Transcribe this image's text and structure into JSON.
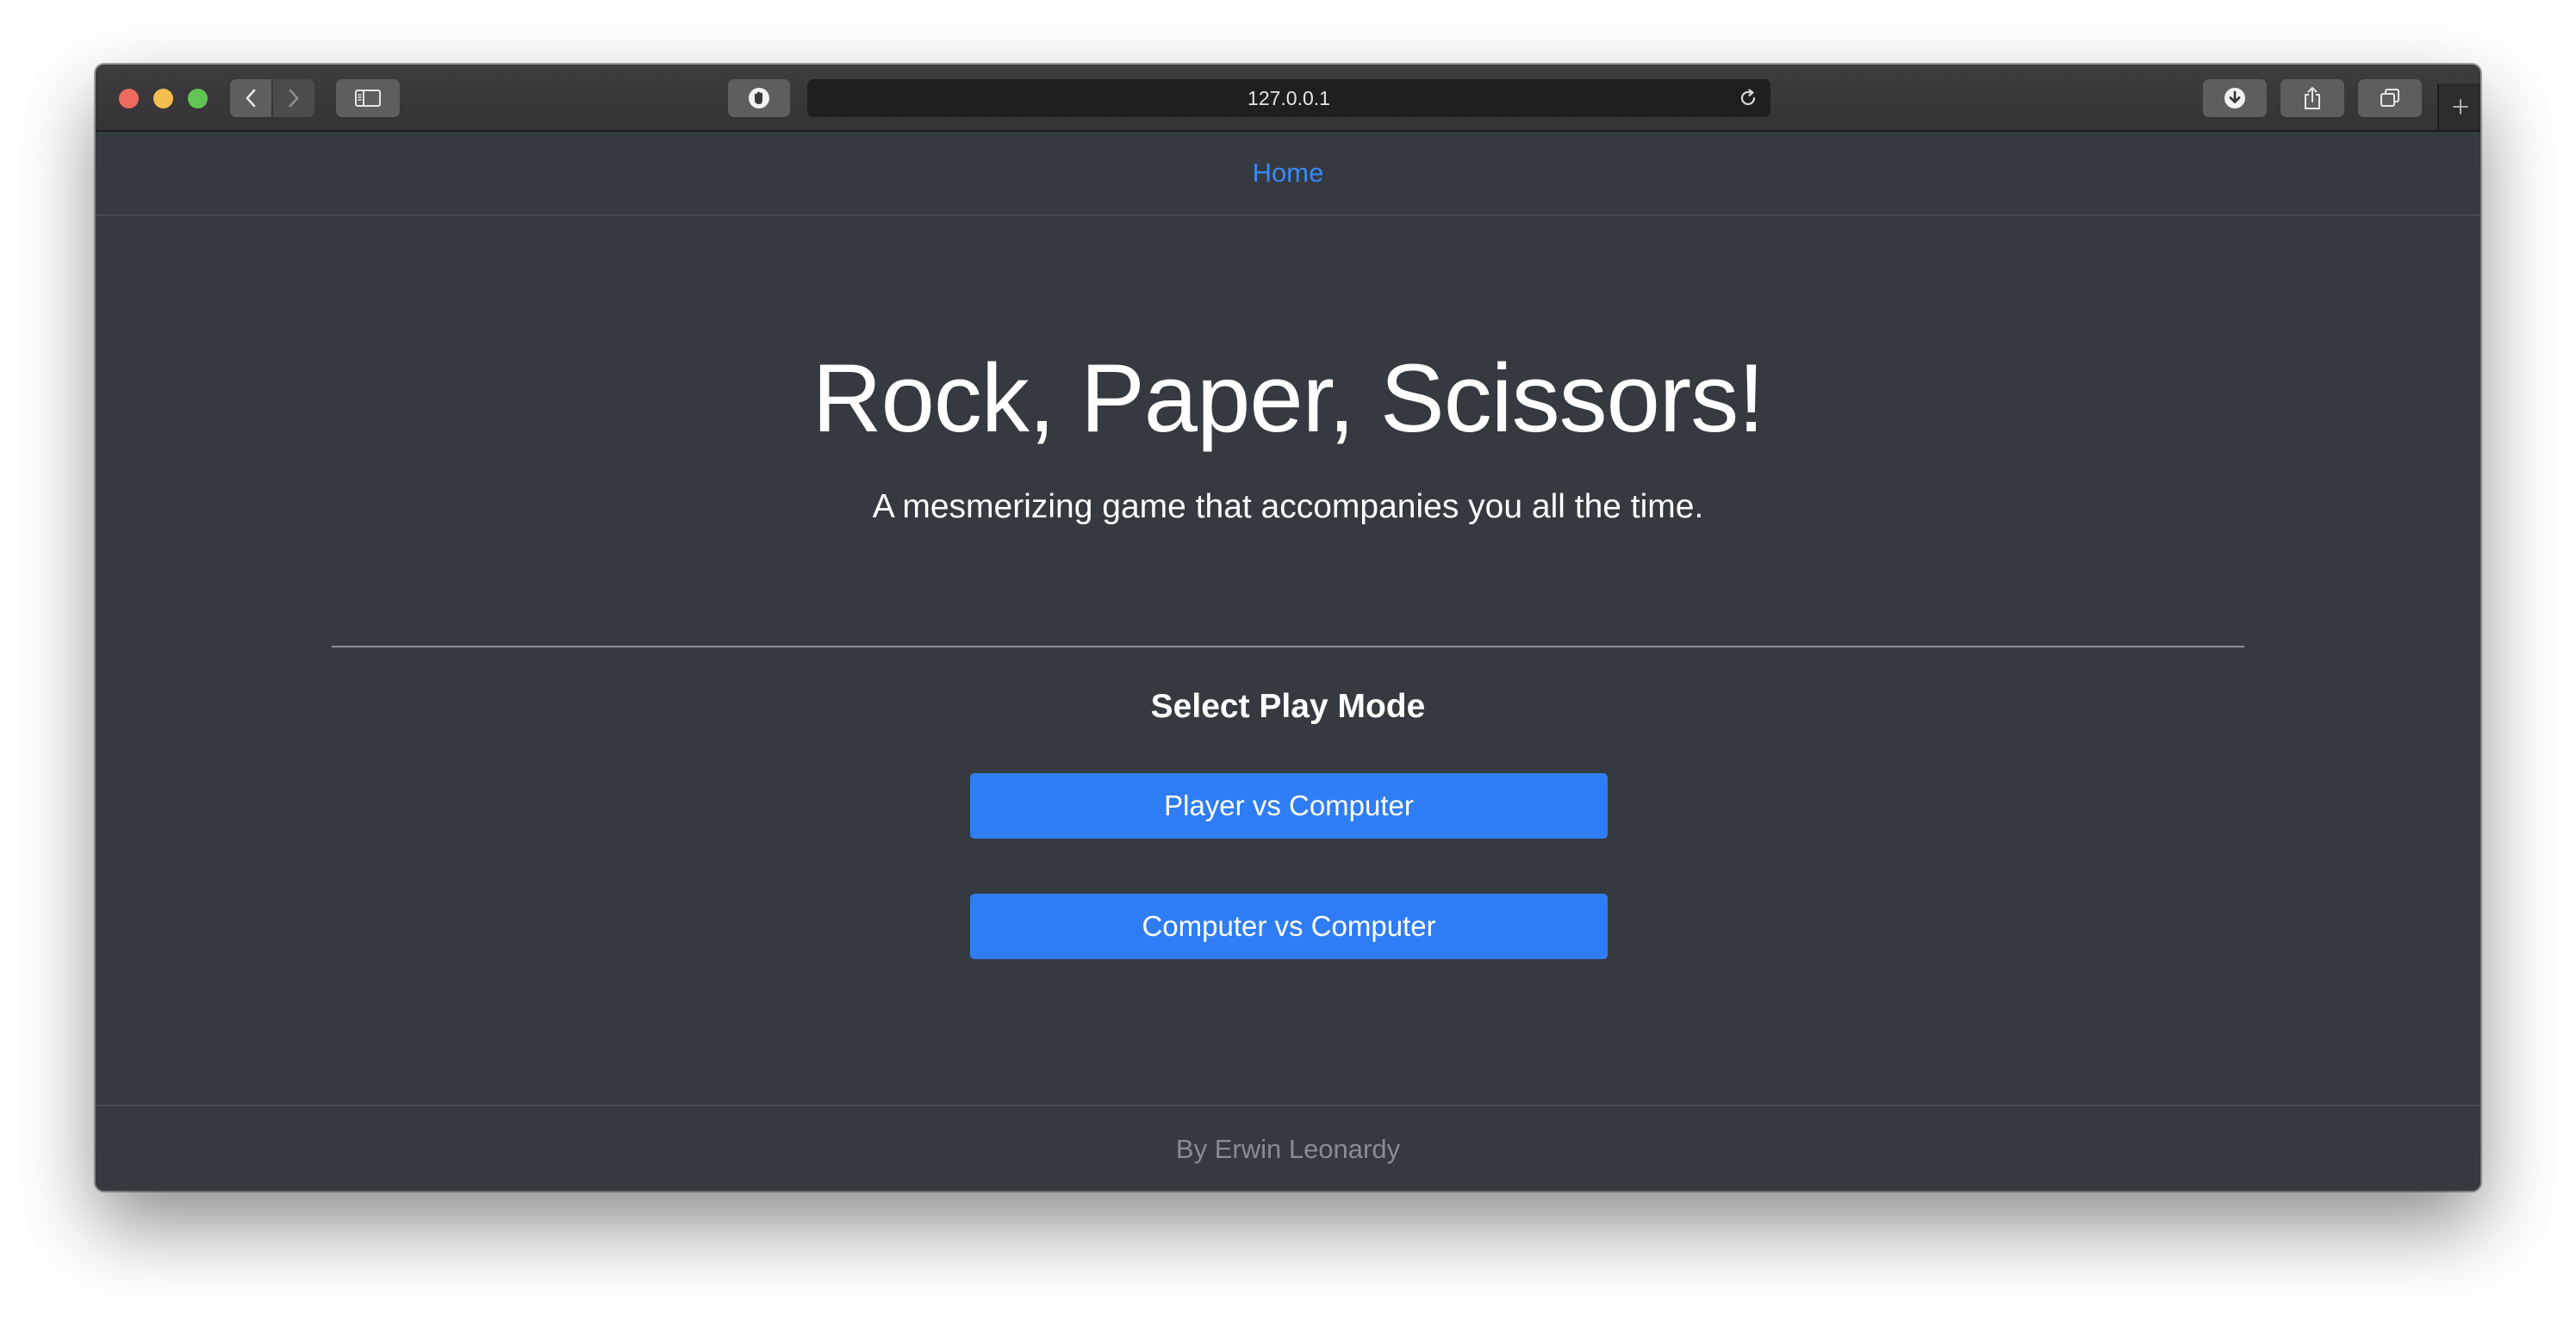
{
  "browser": {
    "address": "127.0.0.1",
    "icons": {
      "back": "chevron-left-icon",
      "forward": "chevron-right-icon",
      "sidebar": "sidebar-icon",
      "privacy": "shield-icon",
      "reload": "reload-icon",
      "download": "download-icon",
      "share": "share-icon",
      "tabs": "tabs-overview-icon",
      "new_tab": "plus-icon"
    }
  },
  "navbar": {
    "home_label": "Home"
  },
  "hero": {
    "title": "Rock, Paper, Scissors!",
    "subtitle": "A mesmerizing game that accompanies you all the time."
  },
  "play_mode": {
    "heading": "Select Play Mode",
    "options": [
      {
        "label": "Player vs Computer"
      },
      {
        "label": "Computer vs Computer"
      }
    ]
  },
  "footer": {
    "credit": "By Erwin Leonardy"
  },
  "colors": {
    "page_bg": "#343a40",
    "accent": "#2f7df4",
    "link": "#3b88f5",
    "footer_text": "#868c93"
  }
}
